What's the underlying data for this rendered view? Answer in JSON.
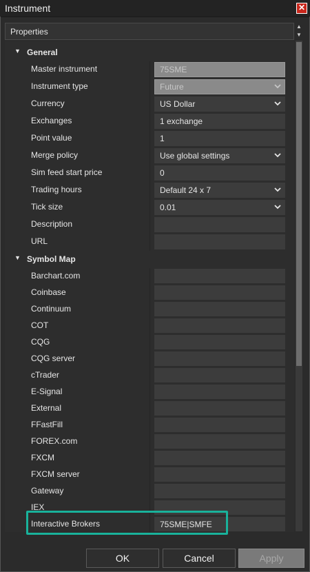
{
  "window": {
    "title": "Instrument"
  },
  "properties_header": "Properties",
  "groups": {
    "general": "General",
    "symbol_map": "Symbol Map"
  },
  "general": [
    {
      "label": "Master instrument",
      "value": "75SME",
      "type": "disabled"
    },
    {
      "label": "Instrument type",
      "value": "Future",
      "type": "disabled-dropdown"
    },
    {
      "label": "Currency",
      "value": "US Dollar",
      "type": "dropdown"
    },
    {
      "label": "Exchanges",
      "value": "1 exchange",
      "type": "text"
    },
    {
      "label": "Point value",
      "value": "1",
      "type": "text"
    },
    {
      "label": "Merge policy",
      "value": "Use global settings",
      "type": "dropdown"
    },
    {
      "label": "Sim feed start price",
      "value": "0",
      "type": "text"
    },
    {
      "label": "Trading hours",
      "value": "Default 24 x 7",
      "type": "dropdown"
    },
    {
      "label": "Tick size",
      "value": "0.01",
      "type": "dropdown"
    },
    {
      "label": "Description",
      "value": "",
      "type": "text"
    },
    {
      "label": "URL",
      "value": "",
      "type": "text"
    }
  ],
  "symbol_map": [
    {
      "label": "Barchart.com",
      "value": ""
    },
    {
      "label": "Coinbase",
      "value": ""
    },
    {
      "label": "Continuum",
      "value": ""
    },
    {
      "label": "COT",
      "value": ""
    },
    {
      "label": "CQG",
      "value": ""
    },
    {
      "label": "CQG server",
      "value": ""
    },
    {
      "label": "cTrader",
      "value": ""
    },
    {
      "label": "E-Signal",
      "value": ""
    },
    {
      "label": "External",
      "value": ""
    },
    {
      "label": "FFastFill",
      "value": ""
    },
    {
      "label": "FOREX.com",
      "value": ""
    },
    {
      "label": "FXCM",
      "value": ""
    },
    {
      "label": "FXCM server",
      "value": ""
    },
    {
      "label": "Gateway",
      "value": ""
    },
    {
      "label": "IEX",
      "value": ""
    },
    {
      "label": "Interactive Brokers",
      "value": "75SME|SMFE"
    }
  ],
  "buttons": {
    "ok": "OK",
    "cancel": "Cancel",
    "apply": "Apply"
  },
  "colors": {
    "highlight": "#19b29b",
    "close": "#c8261b"
  }
}
